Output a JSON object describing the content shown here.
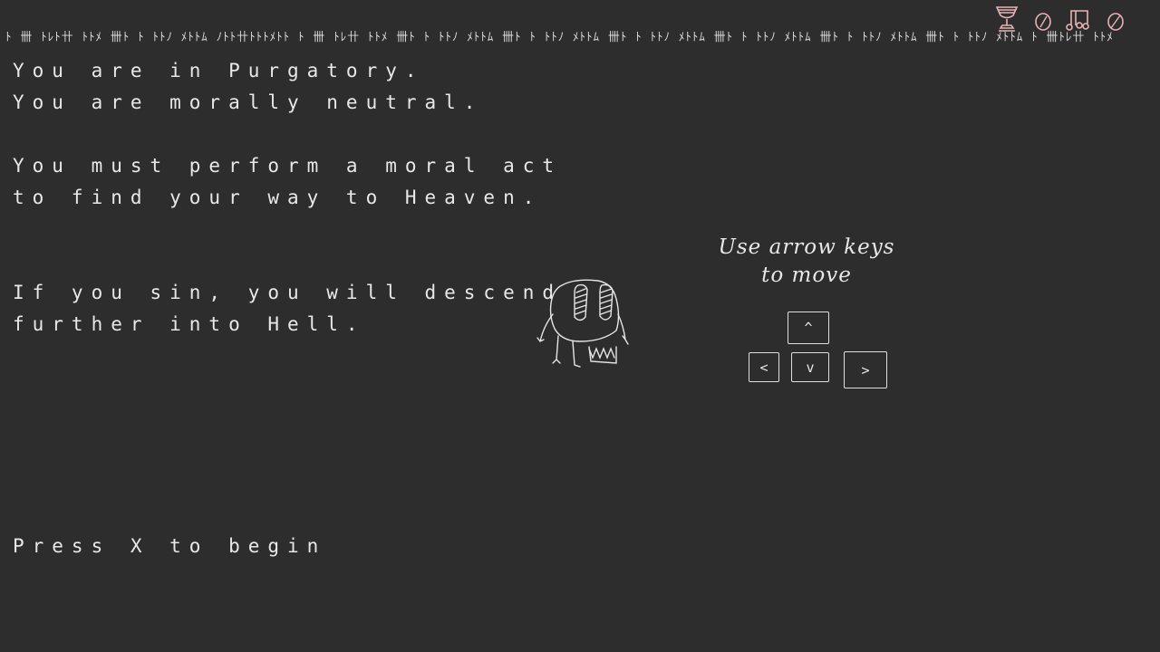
{
  "hud": {
    "tally_marks": "ﾄ 卌 ﾄﾚﾄ卄 ﾄﾄﾒ 卌ﾄ ﾄ ﾄﾄﾉ ﾒﾄﾄﾑ ﾉﾄﾄ卄ﾄﾄﾄﾒﾄﾄ ﾄ 卌 ﾄﾚ卄 ﾄﾄﾒ 卌ﾄ ﾄ ﾄﾄﾉ ﾒﾄﾄﾑ 卌ﾄ ﾄ ﾄﾄﾉ ﾒﾄﾄﾑ 卌ﾄ ﾄ ﾄﾄﾉ ﾒﾄﾄﾑ 卌ﾄ ﾄ ﾄﾄﾉ ﾒﾄﾄﾑ 卌ﾄ ﾄ ﾄﾄﾉ ﾒﾄﾄﾑ 卌ﾄ ﾄ ﾄﾄﾉ ﾒﾄﾄﾑ ﾄ 卌ﾄﾚ卄 ﾄﾄﾒ",
    "icons": [
      "trophy-icon",
      "coin-icon",
      "music-icon",
      "sound-icon"
    ],
    "icon_color": "#e7b3b3"
  },
  "intro": {
    "line1": "You are in Purgatory.",
    "line2": "You are morally neutral.",
    "line3": "You must perform a moral act",
    "line4": "to find your way to Heaven.",
    "line5": "If you sin, you will descend",
    "line6": "further into Hell."
  },
  "prompt": {
    "start": "Press X to begin"
  },
  "controls": {
    "hint_line1": "Use arrow keys",
    "hint_line2": "to move",
    "key_up": "^",
    "key_left": "<",
    "key_down": "v",
    "key_right": ">"
  },
  "player": {
    "sprite": "hand-drawn-creature"
  },
  "colors": {
    "background": "#2d2d2d",
    "text": "#e8e8e8"
  }
}
